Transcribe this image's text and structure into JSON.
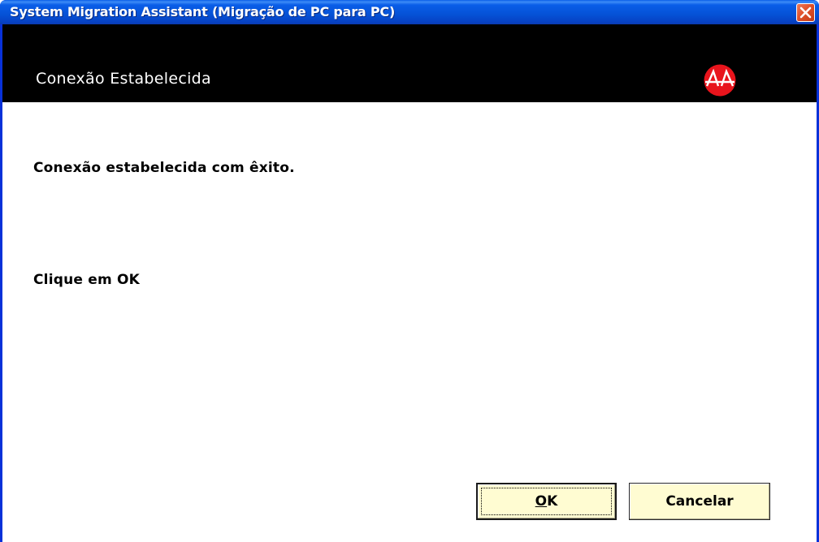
{
  "window": {
    "title": "System Migration Assistant (Migração de PC para PC)"
  },
  "header": {
    "title": "Conexão Estabelecida",
    "logo_icon": "sma-logo-icon"
  },
  "content": {
    "message": "Conexão estabelecida com êxito.",
    "instruction": "Clique em OK"
  },
  "buttons": {
    "ok_label": "OK",
    "cancel_label": "Cancelar"
  },
  "colors": {
    "titlebar": "#0552d6",
    "header_band": "#000000",
    "logo_red": "#e8141c",
    "button_face": "#fffcd2",
    "close_button": "#e0512a"
  }
}
